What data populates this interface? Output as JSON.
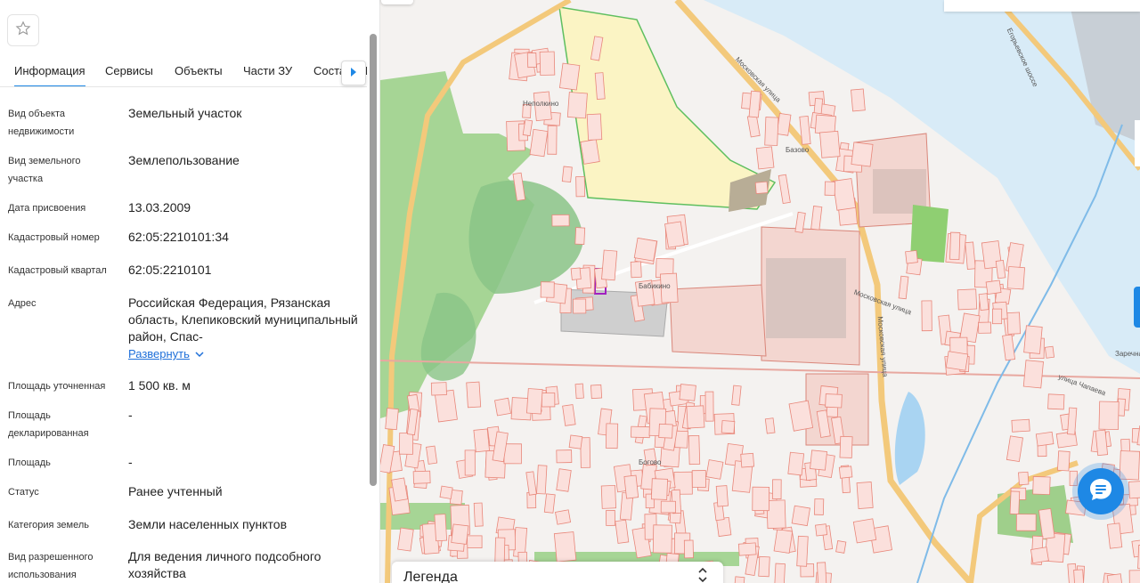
{
  "tabs": [
    "Информация",
    "Сервисы",
    "Объекты",
    "Части ЗУ",
    "Соста",
    "П"
  ],
  "info": [
    {
      "label": "Вид объекта недвижимости",
      "value": "Земельный участок"
    },
    {
      "label": "Вид земельного участка",
      "value": "Землепользование"
    },
    {
      "label": "Дата присвоения",
      "value": "13.03.2009"
    },
    {
      "label": "Кадастровый номер",
      "value": "62:05:2210101:34"
    },
    {
      "label": "Кадастровый квартал",
      "value": "62:05:2210101"
    },
    {
      "label": "Адрес",
      "value": "Российская Федерация, Рязанская область, Клепиковский муниципальный район, Спас-",
      "expand": "Развернуть"
    },
    {
      "label": "Площадь уточненная",
      "value": "1 500 кв. м"
    },
    {
      "label": "Площадь декларированная",
      "value": "-"
    },
    {
      "label": "Площадь",
      "value": "-"
    },
    {
      "label": "Статус",
      "value": "Ранее учтенный"
    },
    {
      "label": "Категория земель",
      "value": "Земли населенных пунктов"
    },
    {
      "label": "Вид разрешенного использования",
      "value": "Для ведения личного подсобного хозяйства"
    }
  ],
  "map_labels": {
    "nepolkino": "Неполкино",
    "bazovo": "Базово",
    "babikino": "Бабикино",
    "moskovskaya_ul": "Московская улица",
    "moskovskaya_ul_v": "Московская улица",
    "moskovskaya_sh": "Московская улица",
    "egorievskoe": "Егорьевское шоссе",
    "zarechnaya": "Заречная",
    "chapaeva": "улица Чапаева",
    "bogovo": "Богово"
  },
  "legend": {
    "title": "Легенда"
  },
  "colors": {
    "accent": "#1e88e5",
    "parcel": "#ffd6d0",
    "parcel_border": "#e8877a",
    "selected": "#a020c0",
    "forest": "#9fd38a",
    "water": "#bfe0f5"
  },
  "icons": {
    "favorite": "star-icon",
    "tab_next": "chevron-right-icon",
    "legend": "chevron-updown-icon",
    "chat": "chat-icon"
  }
}
